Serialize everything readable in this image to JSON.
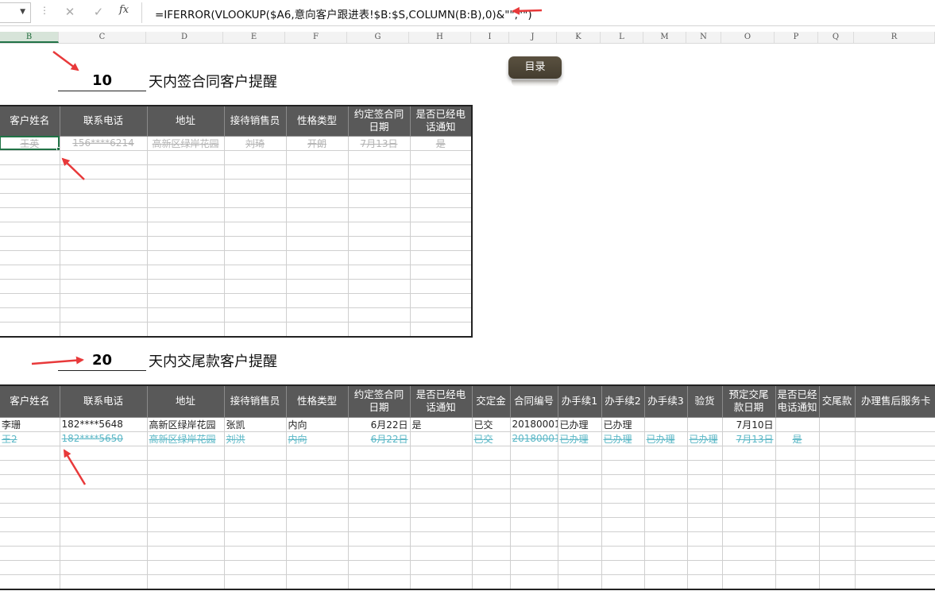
{
  "formula_bar": {
    "formula": "=IFERROR(VLOOKUP($A6,意向客户跟进表!$B:$S,COLUMN(B:B),0)&\"\",\"\")",
    "icons": [
      "dropdown-caret-icon",
      "more-dots-icon",
      "cancel-x-icon",
      "confirm-check-icon",
      "fx-icon"
    ]
  },
  "columns": [
    "B",
    "C",
    "D",
    "E",
    "F",
    "G",
    "H",
    "I",
    "J",
    "K",
    "L",
    "M",
    "N",
    "O",
    "P",
    "Q",
    "R"
  ],
  "buttons": {
    "directory": "目录"
  },
  "section1": {
    "days": "10",
    "title": "天内签合同客户提醒",
    "headers": [
      "客户姓名",
      "联系电话",
      "地址",
      "接待销售员",
      "性格类型",
      "约定签合同日期",
      "是否已经电话通知"
    ],
    "rows": [
      [
        "王英",
        "156****6214",
        "高新区绿岸花园",
        "刘琦",
        "开朗",
        "7月13日",
        "是"
      ]
    ]
  },
  "section2": {
    "days": "20",
    "title": "天内交尾款客户提醒",
    "headers": [
      "客户姓名",
      "联系电话",
      "地址",
      "接待销售员",
      "性格类型",
      "约定签合同日期",
      "是否已经电话通知",
      "交定金",
      "合同编号",
      "办手续1",
      "办手续2",
      "办手续3",
      "验货",
      "预定交尾款日期",
      "是否已经电话通知",
      "交尾款",
      "办理售后服务卡"
    ],
    "rows": [
      [
        "李珊",
        "182****5648",
        "高新区绿岸花园",
        "张凯",
        "内向",
        "6月22日",
        "是",
        "已交",
        "20180001",
        "已办理",
        "已办理",
        "",
        "",
        "7月10日",
        "",
        "",
        ""
      ],
      [
        "王2",
        "182****5650",
        "高新区绿岸花园",
        "刘洪",
        "内向",
        "6月22日",
        "",
        "已交",
        "20180001",
        "已办理",
        "已办理",
        "已办理",
        "已办理",
        "7月13日",
        "是",
        "",
        ""
      ]
    ]
  },
  "colors": {
    "header_bg": "#595959",
    "accent": "#217346",
    "arrow": "#e8393a",
    "button": "#4f4838",
    "strike_cyan": "#5bb7c6"
  }
}
